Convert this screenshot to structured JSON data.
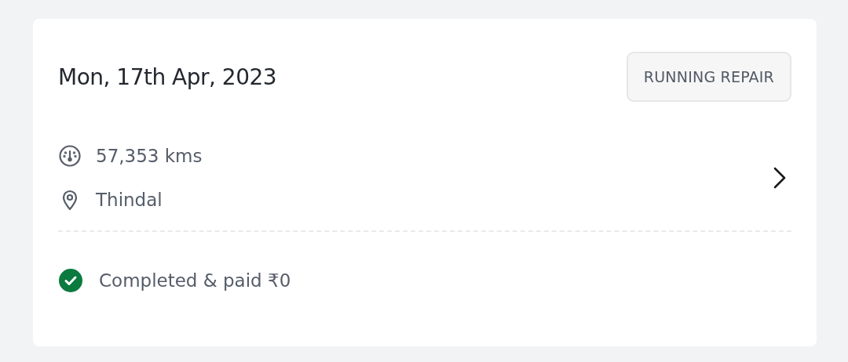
{
  "card": {
    "date": "Mon, 17th Apr, 2023",
    "tag": "RUNNING REPAIR",
    "details": [
      {
        "kind": "odometer",
        "text": "57,353 kms"
      },
      {
        "kind": "location",
        "text": "Thindal"
      }
    ],
    "status": {
      "kind": "completed",
      "text": "Completed & paid ₹0"
    }
  }
}
